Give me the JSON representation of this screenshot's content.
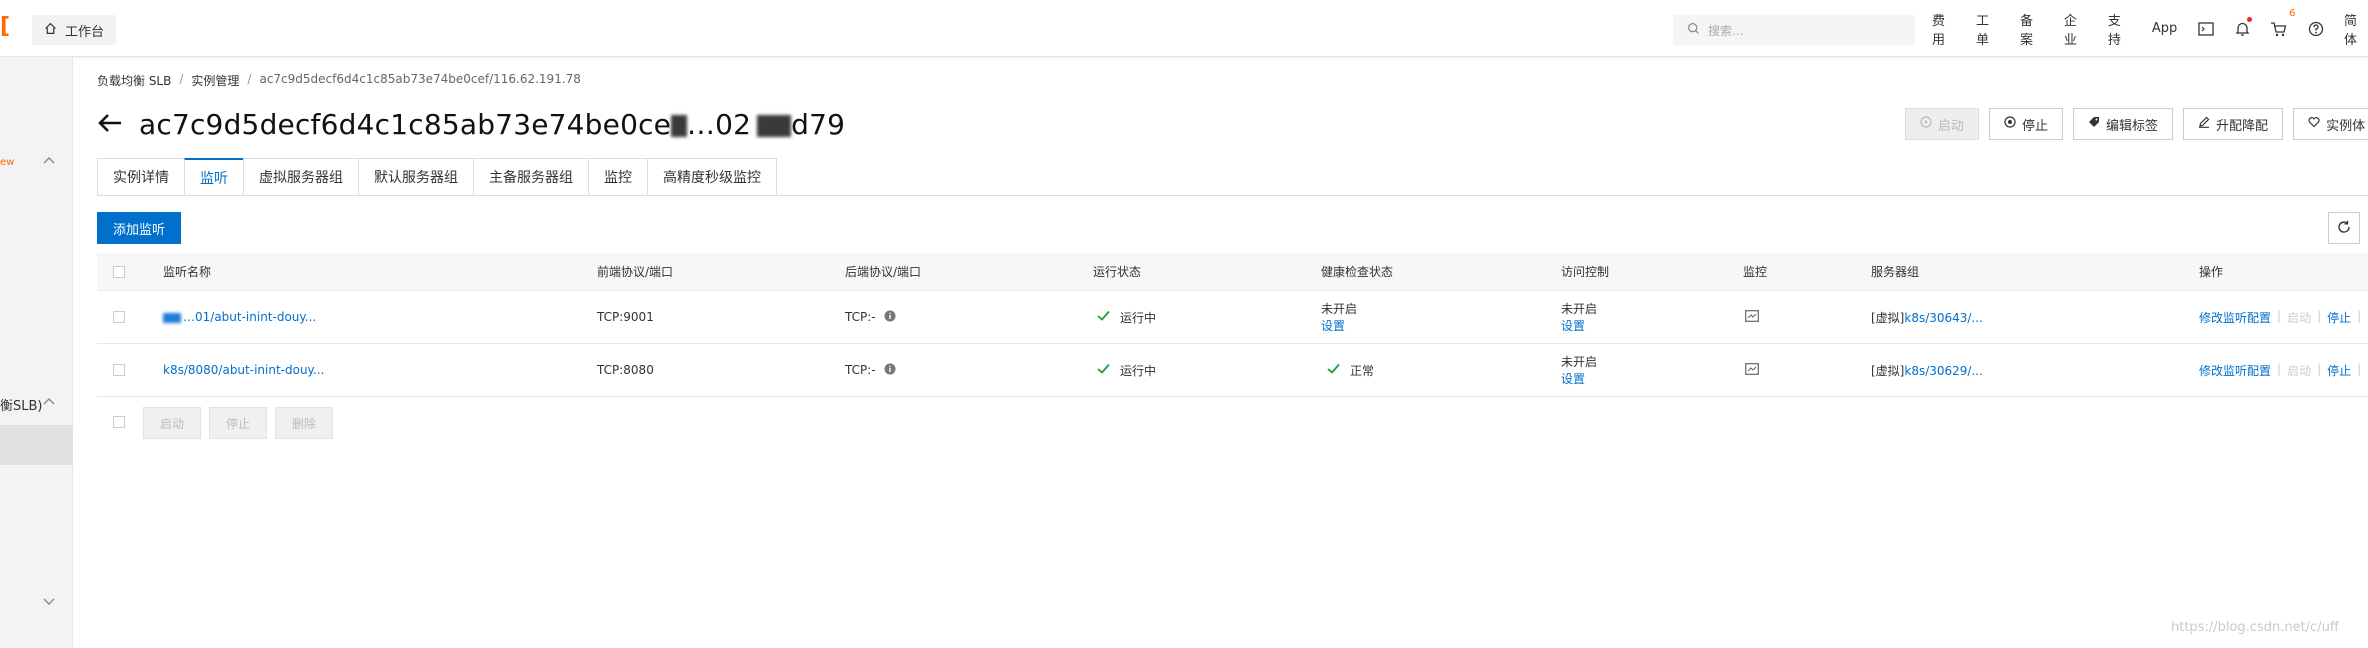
{
  "topbar": {
    "workbench_label": "工作台",
    "search_placeholder": "搜索...",
    "nav": [
      "费用",
      "工单",
      "备案",
      "企业",
      "支持",
      "App"
    ],
    "cart_badge": "6",
    "lang": "简体"
  },
  "sidebar": {
    "new_tag": "ew",
    "slb_label": "衡SLB)"
  },
  "breadcrumb": {
    "items": [
      "负载均衡 SLB",
      "实例管理",
      "ac7c9d5decf6d4c1c85ab73e74be0cef/116.62.191.78"
    ],
    "separator": "/"
  },
  "header": {
    "title": "ac7c9d5decf6d4c1c85ab73e74be0ce",
    "title_tail": ".‥02",
    "title_tail2": "d79"
  },
  "actions": {
    "start": "启动",
    "stop": "停止",
    "edit_tags": "编辑标签",
    "upgrade": "升配降配",
    "instance": "实例体"
  },
  "tabs": [
    "实例详情",
    "监听",
    "虚拟服务器组",
    "默认服务器组",
    "主备服务器组",
    "监控",
    "高精度秒级监控"
  ],
  "active_tab_index": 1,
  "toolbar": {
    "add_listener": "添加监听"
  },
  "table": {
    "headers": {
      "name": "监听名称",
      "frontend": "前端协议/端口",
      "backend": "后端协议/端口",
      "status": "运行状态",
      "health": "健康检查状态",
      "acl": "访问控制",
      "monitor": "监控",
      "server_group": "服务器组",
      "ops": "操作"
    },
    "rows": [
      {
        "name": "…01/abut-inint-douy...",
        "frontend": "TCP:9001",
        "backend": "TCP:-",
        "status": "运行中",
        "health_line1": "未开启",
        "health_line2": "设置",
        "acl_line1": "未开启",
        "acl_line2": "设置",
        "group_prefix": "[虚拟]",
        "group_link": "k8s/30643/...",
        "op_modify": "修改监听配置",
        "op_start": "启动",
        "op_stop": "停止"
      },
      {
        "name": "k8s/8080/abut-inint-douy...",
        "frontend": "TCP:8080",
        "backend": "TCP:-",
        "status": "运行中",
        "health_line1": "正常",
        "health_line2": "",
        "acl_line1": "未开启",
        "acl_line2": "设置",
        "group_prefix": "[虚拟]",
        "group_link": "k8s/30629/...",
        "op_modify": "修改监听配置",
        "op_start": "启动",
        "op_stop": "停止"
      }
    ],
    "footer_buttons": [
      "启动",
      "停止",
      "删除"
    ]
  },
  "watermark": "https://blog.csdn.net/c/uff",
  "colors": {
    "primary": "#0070cc",
    "brand": "#ff6a00",
    "success": "#1e9e3a"
  }
}
